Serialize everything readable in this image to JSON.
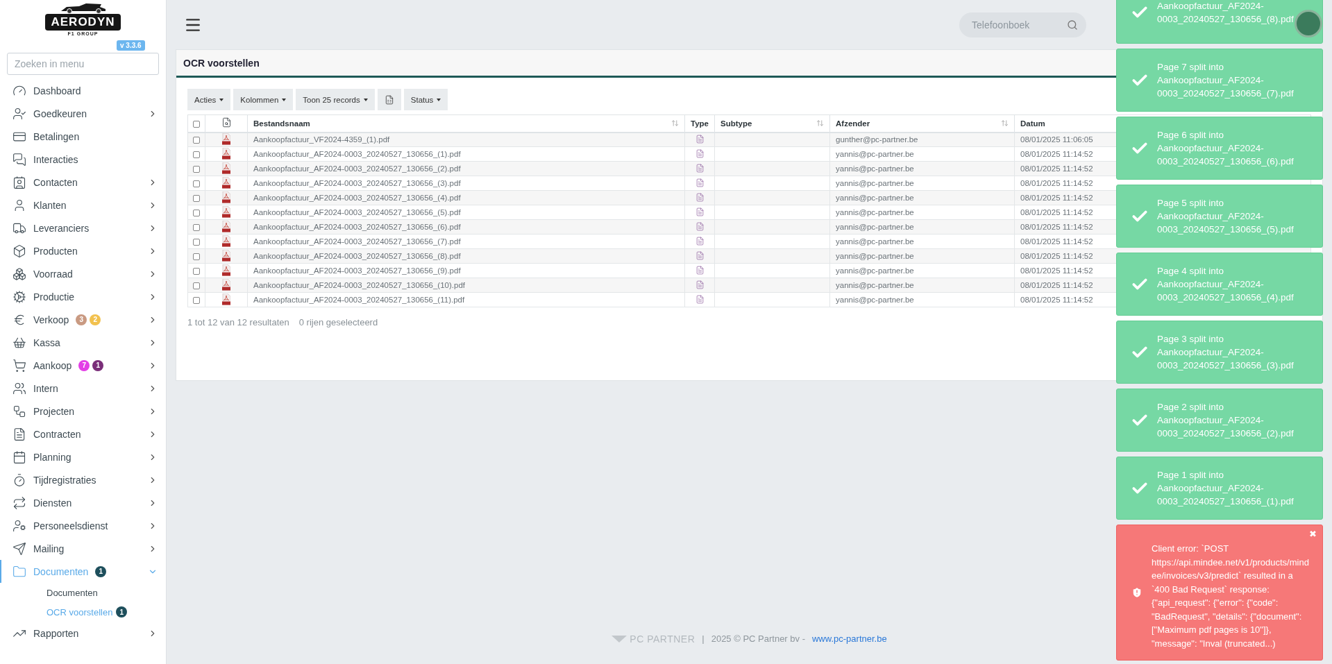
{
  "sidebar": {
    "logo": {
      "name": "AERODYN",
      "tagline": "F1 GROUP"
    },
    "version": "v 3.3.6",
    "search": {
      "placeholder": "Zoeken in menu"
    },
    "items": [
      {
        "label": "Dashboard",
        "kind": "link",
        "selected": false
      },
      {
        "label": "Goedkeuren",
        "kind": "group",
        "selected": false,
        "expanded": false
      },
      {
        "label": "Betalingen",
        "kind": "link",
        "selected": false
      },
      {
        "label": "Interacties",
        "kind": "link",
        "selected": false
      },
      {
        "label": "Contacten",
        "kind": "group",
        "selected": false,
        "expanded": false
      },
      {
        "label": "Klanten",
        "kind": "group",
        "selected": false,
        "expanded": false
      },
      {
        "label": "Leveranciers",
        "kind": "group",
        "selected": false,
        "expanded": false
      },
      {
        "label": "Producten",
        "kind": "group",
        "selected": false,
        "expanded": false
      },
      {
        "label": "Voorraad",
        "kind": "group",
        "selected": false,
        "expanded": false
      },
      {
        "label": "Productie",
        "kind": "group",
        "selected": false,
        "expanded": false
      },
      {
        "label": "Verkoop",
        "kind": "group",
        "selected": false,
        "expanded": false,
        "badges": [
          {
            "text": "3",
            "color": "#c99a82"
          },
          {
            "text": "2",
            "color": "#f2c14e"
          }
        ]
      },
      {
        "label": "Kassa",
        "kind": "group",
        "selected": false,
        "expanded": false
      },
      {
        "label": "Aankoop",
        "kind": "group",
        "selected": false,
        "expanded": false,
        "badges": [
          {
            "text": "7",
            "color": "#e33ee6"
          },
          {
            "text": "1",
            "color": "#7a2e79"
          }
        ]
      },
      {
        "label": "Intern",
        "kind": "group",
        "selected": false,
        "expanded": false
      },
      {
        "label": "Projecten",
        "kind": "group",
        "selected": false,
        "expanded": false
      },
      {
        "label": "Contracten",
        "kind": "group",
        "selected": false,
        "expanded": false
      },
      {
        "label": "Planning",
        "kind": "group",
        "selected": false,
        "expanded": false
      },
      {
        "label": "Tijdregistraties",
        "kind": "group",
        "selected": false,
        "expanded": false
      },
      {
        "label": "Diensten",
        "kind": "group",
        "selected": false,
        "expanded": false
      },
      {
        "label": "Personeelsdienst",
        "kind": "group",
        "selected": false,
        "expanded": false
      },
      {
        "label": "Mailing",
        "kind": "group",
        "selected": false,
        "expanded": false
      },
      {
        "label": "Documenten",
        "kind": "group",
        "selected": true,
        "expanded": true,
        "badges": [
          {
            "text": "1",
            "color": "#1e4f5c"
          }
        ],
        "children": [
          {
            "label": "Documenten",
            "selected": false
          },
          {
            "label": "OCR voorstellen",
            "selected": true,
            "badges": [
              {
                "text": "1",
                "color": "#1e4f5c"
              }
            ]
          }
        ]
      },
      {
        "label": "Rapporten",
        "kind": "group",
        "selected": false,
        "expanded": false
      }
    ]
  },
  "header": {
    "phonebook": {
      "placeholder": "Telefoonboek"
    }
  },
  "card": {
    "title": "OCR voorstellen",
    "toolbar": [
      {
        "label": "Acties",
        "kind": "dropdown"
      },
      {
        "label": "Kolommen",
        "kind": "dropdown"
      },
      {
        "label": "Toon 25 records",
        "kind": "dropdown"
      },
      {
        "kind": "export"
      },
      {
        "label": "Status",
        "kind": "dropdown"
      }
    ],
    "table": {
      "select_all": {
        "checked": false
      },
      "columns": [
        {
          "label": "Bestandsnaam",
          "sortable": true
        },
        {
          "label": "Type",
          "sortable": false
        },
        {
          "label": "Subtype",
          "sortable": true
        },
        {
          "label": "Afzender",
          "sortable": true
        },
        {
          "label": "Datum",
          "sortable": false
        }
      ],
      "rows": [
        {
          "checked": false,
          "filename": "Aankoopfactuur_VF2024-4359_(1).pdf",
          "sender": "gunther@pc-partner.be",
          "date": "08/01/2025 11:06:05"
        },
        {
          "checked": false,
          "filename": "Aankoopfactuur_AF2024-0003_20240527_130656_(1).pdf",
          "sender": "yannis@pc-partner.be",
          "date": "08/01/2025 11:14:52"
        },
        {
          "checked": false,
          "filename": "Aankoopfactuur_AF2024-0003_20240527_130656_(2).pdf",
          "sender": "yannis@pc-partner.be",
          "date": "08/01/2025 11:14:52"
        },
        {
          "checked": false,
          "filename": "Aankoopfactuur_AF2024-0003_20240527_130656_(3).pdf",
          "sender": "yannis@pc-partner.be",
          "date": "08/01/2025 11:14:52"
        },
        {
          "checked": false,
          "filename": "Aankoopfactuur_AF2024-0003_20240527_130656_(4).pdf",
          "sender": "yannis@pc-partner.be",
          "date": "08/01/2025 11:14:52"
        },
        {
          "checked": false,
          "filename": "Aankoopfactuur_AF2024-0003_20240527_130656_(5).pdf",
          "sender": "yannis@pc-partner.be",
          "date": "08/01/2025 11:14:52"
        },
        {
          "checked": false,
          "filename": "Aankoopfactuur_AF2024-0003_20240527_130656_(6).pdf",
          "sender": "yannis@pc-partner.be",
          "date": "08/01/2025 11:14:52"
        },
        {
          "checked": false,
          "filename": "Aankoopfactuur_AF2024-0003_20240527_130656_(7).pdf",
          "sender": "yannis@pc-partner.be",
          "date": "08/01/2025 11:14:52"
        },
        {
          "checked": false,
          "filename": "Aankoopfactuur_AF2024-0003_20240527_130656_(8).pdf",
          "sender": "yannis@pc-partner.be",
          "date": "08/01/2025 11:14:52"
        },
        {
          "checked": false,
          "filename": "Aankoopfactuur_AF2024-0003_20240527_130656_(9).pdf",
          "sender": "yannis@pc-partner.be",
          "date": "08/01/2025 11:14:52"
        },
        {
          "checked": false,
          "filename": "Aankoopfactuur_AF2024-0003_20240527_130656_(10).pdf",
          "sender": "yannis@pc-partner.be",
          "date": "08/01/2025 11:14:52"
        },
        {
          "checked": false,
          "filename": "Aankoopfactuur_AF2024-0003_20240527_130656_(11).pdf",
          "sender": "yannis@pc-partner.be",
          "date": "08/01/2025 11:14:52"
        }
      ]
    },
    "summary": "1 tot 12 van 12 resultaten",
    "selection": "0 rijen geselecteerd"
  },
  "footer": {
    "logo": "PC PARTNER",
    "separator": "|",
    "copyright": "2025 © PC Partner bv -",
    "link": "www.pc-partner.be"
  },
  "toasts": [
    {
      "kind": "success",
      "message": "Aankoopfactuur_AF2024-0003_20240527_130656_(8).pdf"
    },
    {
      "kind": "success",
      "title": "Page 7 split into",
      "message": "Aankoopfactuur_AF2024-0003_20240527_130656_(7).pdf"
    },
    {
      "kind": "success",
      "title": "Page 6 split into",
      "message": "Aankoopfactuur_AF2024-0003_20240527_130656_(6).pdf"
    },
    {
      "kind": "success",
      "title": "Page 5 split into",
      "message": "Aankoopfactuur_AF2024-0003_20240527_130656_(5).pdf"
    },
    {
      "kind": "success",
      "title": "Page 4 split into",
      "message": "Aankoopfactuur_AF2024-0003_20240527_130656_(4).pdf"
    },
    {
      "kind": "success",
      "title": "Page 3 split into",
      "message": "Aankoopfactuur_AF2024-0003_20240527_130656_(3).pdf"
    },
    {
      "kind": "success",
      "title": "Page 2 split into",
      "message": "Aankoopfactuur_AF2024-0003_20240527_130656_(2).pdf"
    },
    {
      "kind": "success",
      "title": "Page 1 split into",
      "message": "Aankoopfactuur_AF2024-0003_20240527_130656_(1).pdf"
    },
    {
      "kind": "error",
      "close": "✖",
      "message": "Client error: `POST https://api.mindee.net/v1/products/mindee/invoices/v3/predict` resulted in a `400 Bad Request` response: {\"api_request\": {\"error\": {\"code\": \"BadRequest\", \"details\": {\"document\": [\"Maximum pdf pages is 10\"]}, \"message\": \"Inval (truncated...)"
    }
  ]
}
